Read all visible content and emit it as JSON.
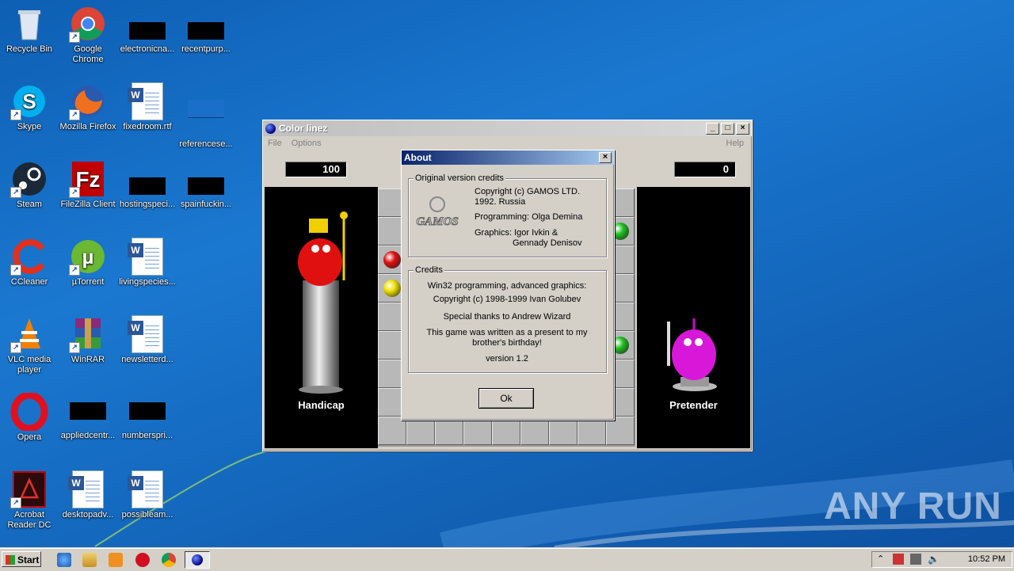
{
  "desktop": {
    "icons": [
      {
        "label": "Recycle Bin"
      },
      {
        "label": "Google Chrome"
      },
      {
        "label": "electronicna..."
      },
      {
        "label": "recentpurp..."
      },
      {
        "label": "Skype"
      },
      {
        "label": "Mozilla Firefox"
      },
      {
        "label": "fixedroom.rtf"
      },
      {
        "label": "referencese..."
      },
      {
        "label": "Steam"
      },
      {
        "label": "FileZilla Client"
      },
      {
        "label": "hostingspeci..."
      },
      {
        "label": "spainfuckin..."
      },
      {
        "label": "CCleaner"
      },
      {
        "label": "µTorrent"
      },
      {
        "label": "livingspecies..."
      },
      {
        "label": "VLC media player"
      },
      {
        "label": "WinRAR"
      },
      {
        "label": "newsletterd..."
      },
      {
        "label": "Opera"
      },
      {
        "label": "appliedcentr..."
      },
      {
        "label": "numberspri..."
      },
      {
        "label": "Acrobat Reader DC"
      },
      {
        "label": "desktopadv..."
      },
      {
        "label": "possibleam..."
      }
    ],
    "watermark": "ANY RUN"
  },
  "window": {
    "title": "Color linez",
    "menu": {
      "file": "File",
      "options": "Options",
      "help": "Help"
    },
    "score_left": "100",
    "score_right": "0",
    "player_left": "Handicap",
    "player_right": "Pretender",
    "colors": {
      "red": "#e01010",
      "yellow": "#f0e000",
      "green": "#20c020"
    }
  },
  "about": {
    "title": "About",
    "close": "×",
    "original_credits_title": "Original version credits",
    "logo_text": "GAMOS",
    "copyright_line1": "Copyright (c) GAMOS LTD.",
    "copyright_line2": "1992. Russia",
    "programming": "Programming: Olga Demina",
    "graphics_line1": "Graphics: Igor Ivkin &",
    "graphics_line2": "Gennady Denisov",
    "credits_title": "Credits",
    "win32_line": "Win32 programming, advanced graphics:",
    "copyright_2": "Copyright (c) 1998-1999 Ivan Golubev",
    "thanks": "Special thanks to Andrew Wizard",
    "present_line1": "This game was written as a present to my",
    "present_line2": "brother's birthday!",
    "version": "version 1.2",
    "ok": "Ok"
  },
  "taskbar": {
    "start": "Start",
    "clock": "10:52 PM"
  }
}
